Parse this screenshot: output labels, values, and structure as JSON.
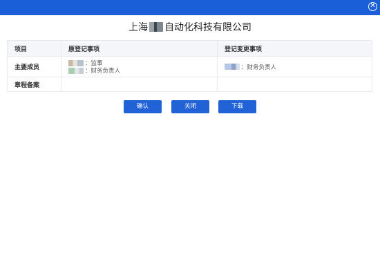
{
  "window": {
    "close_icon": "close-circle-icon",
    "accent": "#1a5fd8"
  },
  "title": {
    "prefix": "上海",
    "suffix": "自动化科技有限公司"
  },
  "table": {
    "headers": [
      "项目",
      "原登记事项",
      "登记变更事项"
    ],
    "rows": [
      {
        "label": "主要成员",
        "original": [
          {
            "role": "：监事"
          },
          {
            "role": "：财务负责人"
          }
        ],
        "changed": [
          {
            "role": "：财务负责人"
          }
        ]
      },
      {
        "label": "章程备案",
        "original": [],
        "changed": []
      }
    ]
  },
  "buttons": {
    "confirm": "确认",
    "close": "关闭",
    "download": "下载",
    "color": "#2163d6"
  }
}
